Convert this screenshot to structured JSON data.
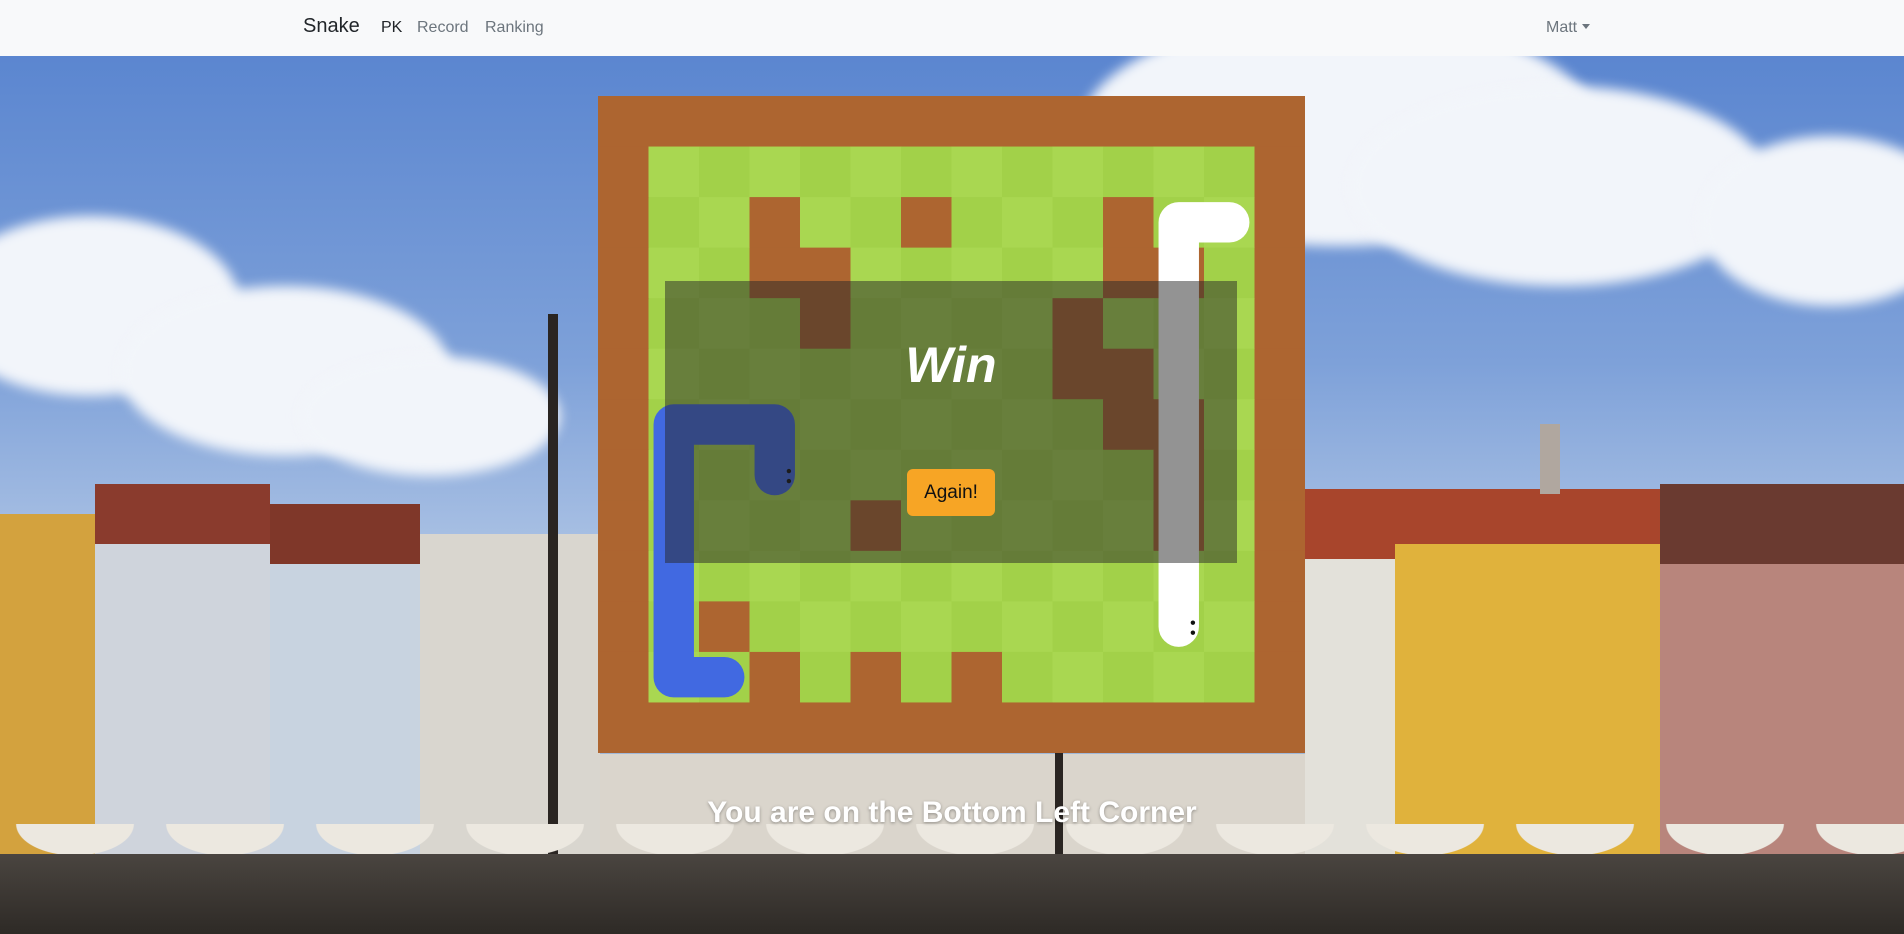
{
  "navbar": {
    "brand": "Snake",
    "links": [
      "PK",
      "Record",
      "Ranking"
    ],
    "user": "Matt"
  },
  "game": {
    "result": "Win",
    "again_label": "Again!",
    "status": "You are on the Bottom Left Corner",
    "rows": 13,
    "cols": 14,
    "walls": [
      [
        2,
        3
      ],
      [
        2,
        6
      ],
      [
        3,
        3
      ],
      [
        3,
        4
      ],
      [
        4,
        4
      ],
      [
        4,
        9
      ],
      [
        5,
        9
      ],
      [
        5,
        10
      ],
      [
        6,
        10
      ],
      [
        8,
        5
      ],
      [
        10,
        2
      ],
      [
        11,
        3
      ],
      [
        11,
        5
      ],
      [
        11,
        7
      ],
      [
        12,
        3
      ],
      [
        12,
        5
      ],
      [
        12,
        7
      ],
      [
        2,
        10
      ],
      [
        3,
        10
      ],
      [
        3,
        11
      ],
      [
        6,
        11
      ],
      [
        7,
        11
      ],
      [
        8,
        11
      ]
    ],
    "snake_blue": [
      [
        11,
        2
      ],
      [
        11,
        1
      ],
      [
        10,
        1
      ],
      [
        9,
        1
      ],
      [
        8,
        1
      ],
      [
        7,
        1
      ],
      [
        6,
        1
      ],
      [
        6,
        2
      ],
      [
        6,
        3
      ],
      [
        7,
        3
      ]
    ],
    "snake_white": [
      [
        2,
        12
      ],
      [
        2,
        11
      ],
      [
        3,
        11
      ],
      [
        4,
        11
      ],
      [
        5,
        11
      ],
      [
        6,
        11
      ],
      [
        7,
        11
      ],
      [
        8,
        11
      ],
      [
        9,
        11
      ],
      [
        10,
        11
      ]
    ]
  },
  "colors": {
    "wall": "#ad6530",
    "grass_light": "#a9d751",
    "grass_dark": "#a2d149",
    "snake_blue": "#4169e1",
    "snake_white": "#ffffff",
    "button": "#f7a525"
  }
}
